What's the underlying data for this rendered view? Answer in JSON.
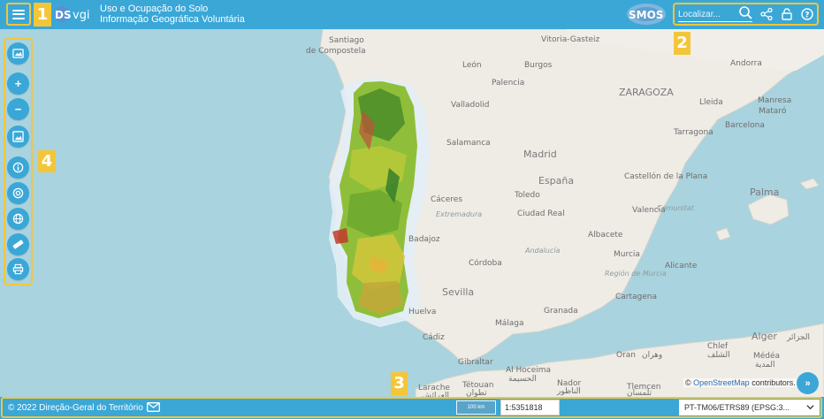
{
  "header": {
    "logo_text": "vgi",
    "title_line1": "Uso e Ocupação do Solo",
    "title_line2": "Informação Geográfica Voluntária",
    "smos_text": "SMOS",
    "search_placeholder": "Localizar...",
    "icons": [
      "menu-icon",
      "search-icon",
      "share-icon",
      "login-icon",
      "help-icon"
    ]
  },
  "callouts": {
    "one": "1",
    "two": "2",
    "three": "3",
    "four": "4"
  },
  "left_toolbar": {
    "buttons": [
      "image-icon",
      "zoom-in-icon",
      "zoom-out-icon",
      "image-icon",
      "info-icon",
      "target-icon",
      "globe-icon",
      "ruler-icon",
      "print-icon"
    ],
    "zoom_in_label": "+",
    "zoom_out_label": "−"
  },
  "map": {
    "places": {
      "santiago": "Santiago",
      "de_compostela": "de Compostela",
      "vitoria": "Vitoria-Gasteiz",
      "leon": "León",
      "burgos": "Burgos",
      "palencia": "Palencia",
      "andorra": "Andorra",
      "zaragoza": "ZARAGOZA",
      "valladolid": "Valladolid",
      "lleida": "Lleida",
      "manresa": "Manresa",
      "mataro": "Mataró",
      "tarragona": "Tarragona",
      "barcelona": "Barcelona",
      "salamanca": "Salamanca",
      "madrid": "Madrid",
      "espana": "España",
      "toledo": "Toledo",
      "castellon": "Castellón de la Plana",
      "palma": "Palma",
      "caceres": "Cáceres",
      "extremadura": "Extremadura",
      "ciudad_real": "Ciudad Real",
      "valencia": "Valencia",
      "comunitat": "Comunitat",
      "badajoz": "Badajoz",
      "albacete": "Albacete",
      "andalucia": "Andalucía",
      "cordoba": "Córdoba",
      "murcia": "Murcia",
      "region_murcia": "Región de Murcia",
      "alicante": "Alicante",
      "sevilla": "Sevilla",
      "huelva": "Huelva",
      "cartagena": "Cartagena",
      "granada": "Granada",
      "malaga": "Málaga",
      "cadiz": "Cádiz",
      "gibraltar": "Gibraltar",
      "alger": "Alger",
      "alger_ar": "الجزائر",
      "oran": "Oran",
      "oran_ar": "وهران",
      "chlef": "Chlef",
      "chlef_ar": "الشلف",
      "medea": "Médéa",
      "medea_ar": "المدية",
      "al_hoceima": "Al Hoceima",
      "al_hoceima_ar": "الحسيمة",
      "tetouan": "Tétouan",
      "tetouan_ar": "تطوان",
      "larache": "Larache",
      "larache_ar": "العرائش",
      "tlemcen": "Tlemcen",
      "tlemcen_ar": "تلمسان",
      "nador": "Nador",
      "nador_ar": "الناظور"
    }
  },
  "attribution": {
    "prefix": "© ",
    "link": "OpenStreetMap",
    "suffix": " contributors."
  },
  "expand_label": "»",
  "footer": {
    "copyright": "© 2022 Direção-Geral do Território",
    "scale_bar": "100 km",
    "scale_value": "1:5351818",
    "crs": "PT-TM06/ETRS89 (EPSG:3..."
  },
  "colors": {
    "header": "#3aa7d7",
    "callout": "#f3c63a",
    "sea": "#a9d3de",
    "land": "#efece6"
  }
}
